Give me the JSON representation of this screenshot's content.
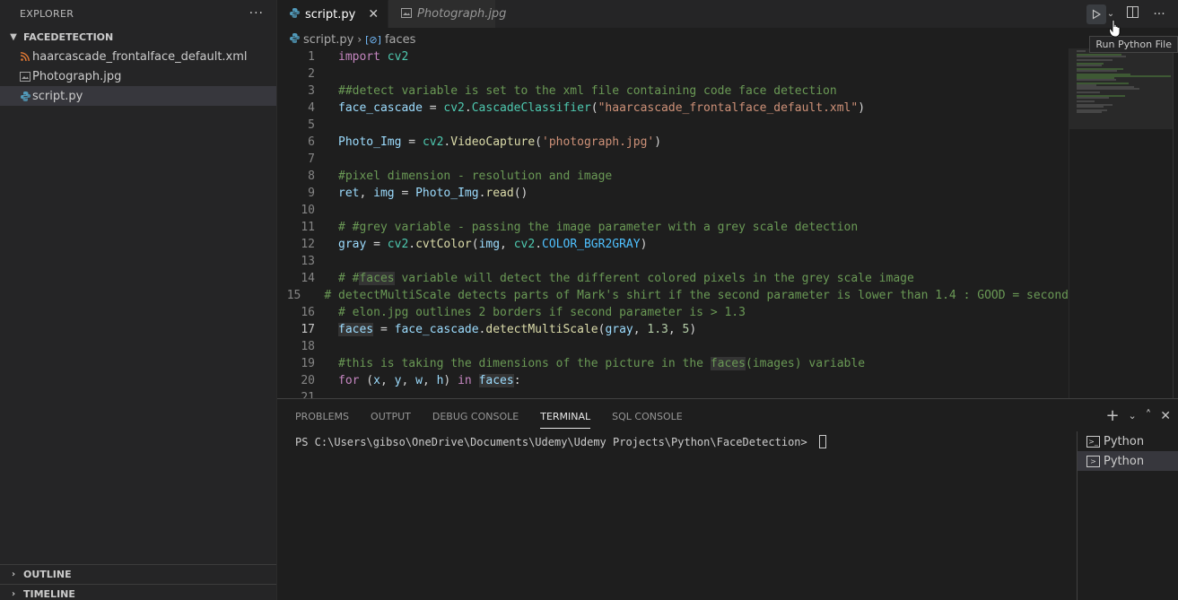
{
  "explorer": {
    "title": "EXPLORER",
    "more_icon": "ellipsis-icon",
    "folder": "FACEDETECTION",
    "files": [
      {
        "name": "haarcascade_frontalface_default.xml",
        "icon": "rss-icon",
        "color": "#e37933"
      },
      {
        "name": "Photograph.jpg",
        "icon": "image-icon",
        "color": "#a0a0a0"
      },
      {
        "name": "script.py",
        "icon": "python-icon",
        "color": "#519aba"
      }
    ],
    "outline": "OUTLINE",
    "timeline": "TIMELINE"
  },
  "tabs": [
    {
      "label": "script.py",
      "active": true
    },
    {
      "label": "Photograph.jpg",
      "active": false
    }
  ],
  "tab_actions": {
    "tooltip": "Run Python File"
  },
  "breadcrumb": {
    "file": "script.py",
    "symbol": "faces"
  },
  "code_lines": [
    {
      "n": "1"
    },
    {
      "n": "2"
    },
    {
      "n": "3"
    },
    {
      "n": "4"
    },
    {
      "n": "5"
    },
    {
      "n": "6"
    },
    {
      "n": "7"
    },
    {
      "n": "8"
    },
    {
      "n": "9"
    },
    {
      "n": "10"
    },
    {
      "n": "11"
    },
    {
      "n": "12"
    },
    {
      "n": "13"
    },
    {
      "n": "14"
    },
    {
      "n": "15"
    },
    {
      "n": "16"
    },
    {
      "n": "17"
    },
    {
      "n": "18"
    },
    {
      "n": "19"
    },
    {
      "n": "20"
    },
    {
      "n": "21"
    }
  ],
  "code": {
    "l1": [
      "import",
      " ",
      "cv2"
    ],
    "l3": "##detect variable is set to the xml file containing code face detection",
    "l4": [
      "face_cascade",
      " = ",
      "cv2",
      ".",
      "CascadeClassifier",
      "(",
      "\"haarcascade_frontalface_default.xml\"",
      ")"
    ],
    "l6": [
      "Photo_Img",
      " = ",
      "cv2",
      ".",
      "VideoCapture",
      "(",
      "'photograph.jpg'",
      ")"
    ],
    "l8": "#pixel dimension - resolution and image",
    "l9": [
      "ret",
      ", ",
      "img",
      " = ",
      "Photo_Img",
      ".",
      "read",
      "()"
    ],
    "l11": "# #grey variable - passing the image parameter with a grey scale detection",
    "l12": [
      "gray",
      " = ",
      "cv2",
      ".",
      "cvtColor",
      "(",
      "img",
      ", ",
      "cv2",
      ".",
      "COLOR_BGR2GRAY",
      ")"
    ],
    "l14": [
      "# #",
      "faces",
      " variable will detect the different colored pixels in the grey scale image"
    ],
    "l15": "# detectMultiScale detects parts of Mark's shirt if the second parameter is lower than 1.4 : GOOD = second",
    "l16": "# elon.jpg outlines 2 borders if second parameter is > 1.3",
    "l17": [
      "faces",
      " = ",
      "face_cascade",
      ".",
      "detectMultiScale",
      "(",
      "gray",
      ", ",
      "1.3",
      ", ",
      "5",
      ")"
    ],
    "l19": [
      "#this is taking the dimensions of the picture in the ",
      "faces",
      "(images) variable"
    ],
    "l20": [
      "for",
      " (",
      "x",
      ", ",
      "y",
      ", ",
      "w",
      ", ",
      "h",
      ") ",
      "in",
      " ",
      "faces",
      ":"
    ]
  },
  "panel": {
    "tabs": [
      "PROBLEMS",
      "OUTPUT",
      "DEBUG CONSOLE",
      "TERMINAL",
      "SQL CONSOLE"
    ],
    "active_tab": "TERMINAL",
    "prompt": "PS C:\\Users\\gibso\\OneDrive\\Documents\\Udemy\\Udemy Projects\\Python\\FaceDetection> ",
    "terminals": [
      "Python",
      "Python"
    ]
  }
}
